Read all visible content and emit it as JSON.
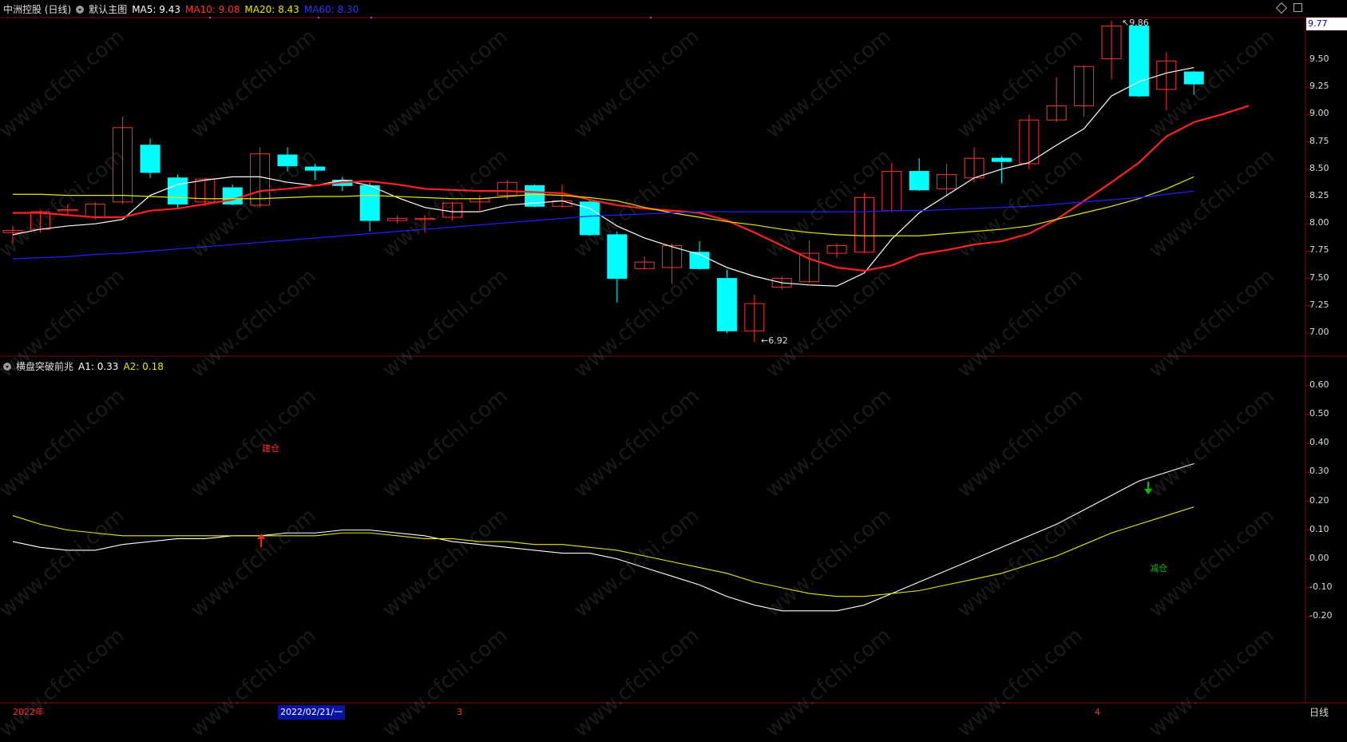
{
  "main_panel": {
    "stock_name": "中洲控股 (日线)",
    "template_label": "默认主图",
    "ma5": "MA5: 9.43",
    "ma10": "MA10: 9.08",
    "ma20": "MA20: 8.43",
    "ma60": "MA60: 8.30",
    "current_price_box": "9.77",
    "high_marker": "9.86",
    "low_marker": "6.92",
    "y_ticks": [
      "9.50",
      "9.25",
      "9.00",
      "8.75",
      "8.50",
      "8.25",
      "8.00",
      "7.75",
      "7.50",
      "7.25",
      "7.00"
    ]
  },
  "indicator_panel": {
    "name": "横盘突破前兆",
    "a1": "A1: 0.33",
    "a2": "A2: 0.18",
    "label_build": "建仓",
    "label_reduce": "减仓",
    "y_ticks": [
      "0.60",
      "0.50",
      "0.40",
      "0.30",
      "0.20",
      "0.10",
      "0.00",
      "-0.10",
      "-0.20"
    ]
  },
  "bottom_bar": {
    "year_label": "2022年",
    "date_cursor": "2022/02/21/一",
    "month_3": "3",
    "month_4": "4",
    "period_button": "日线"
  },
  "watermark": "www.cfchi.com",
  "colors": {
    "up": "#ff3232",
    "down": "#00ffff",
    "ma5": "#ffffff",
    "ma10": "#ff2020",
    "ma20": "#e8e800",
    "ma60": "#2020ff",
    "grid": "#7a1010"
  },
  "chart_data": {
    "type": "candlestick",
    "y_range": [
      6.82,
      9.86
    ],
    "candles": [
      {
        "o": 7.92,
        "h": 7.98,
        "l": 7.82,
        "c": 7.94
      },
      {
        "o": 7.95,
        "h": 8.13,
        "l": 7.92,
        "c": 8.11
      },
      {
        "o": 8.13,
        "h": 8.18,
        "l": 8.07,
        "c": 8.13
      },
      {
        "o": 8.06,
        "h": 8.2,
        "l": 8.04,
        "c": 8.18
      },
      {
        "o": 8.2,
        "h": 8.98,
        "l": 8.18,
        "c": 8.88
      },
      {
        "o": 8.72,
        "h": 8.78,
        "l": 8.42,
        "c": 8.47
      },
      {
        "o": 8.42,
        "h": 8.45,
        "l": 8.13,
        "c": 8.18
      },
      {
        "o": 8.2,
        "h": 8.42,
        "l": 8.16,
        "c": 8.41
      },
      {
        "o": 8.33,
        "h": 8.36,
        "l": 8.17,
        "c": 8.18
      },
      {
        "o": 8.17,
        "h": 8.7,
        "l": 8.15,
        "c": 8.64
      },
      {
        "o": 8.63,
        "h": 8.7,
        "l": 8.48,
        "c": 8.53
      },
      {
        "o": 8.52,
        "h": 8.55,
        "l": 8.4,
        "c": 8.49
      },
      {
        "o": 8.4,
        "h": 8.43,
        "l": 8.3,
        "c": 8.35
      },
      {
        "o": 8.35,
        "h": 8.38,
        "l": 7.93,
        "c": 8.03
      },
      {
        "o": 8.03,
        "h": 8.08,
        "l": 8.0,
        "c": 8.05
      },
      {
        "o": 8.05,
        "h": 8.08,
        "l": 7.92,
        "c": 8.05
      },
      {
        "o": 8.06,
        "h": 8.2,
        "l": 8.03,
        "c": 8.19
      },
      {
        "o": 8.2,
        "h": 8.26,
        "l": 8.12,
        "c": 8.23
      },
      {
        "o": 8.26,
        "h": 8.4,
        "l": 8.22,
        "c": 8.38
      },
      {
        "o": 8.35,
        "h": 8.36,
        "l": 8.15,
        "c": 8.16
      },
      {
        "o": 8.16,
        "h": 8.36,
        "l": 8.15,
        "c": 8.21
      },
      {
        "o": 8.2,
        "h": 8.22,
        "l": 7.89,
        "c": 7.9
      },
      {
        "o": 7.9,
        "h": 7.93,
        "l": 7.28,
        "c": 7.5
      },
      {
        "o": 7.59,
        "h": 7.7,
        "l": 7.58,
        "c": 7.65
      },
      {
        "o": 7.6,
        "h": 7.82,
        "l": 7.45,
        "c": 7.8
      },
      {
        "o": 7.74,
        "h": 7.84,
        "l": 7.58,
        "c": 7.59
      },
      {
        "o": 7.5,
        "h": 7.58,
        "l": 7.0,
        "c": 7.02
      },
      {
        "o": 7.02,
        "h": 7.35,
        "l": 6.92,
        "c": 7.27
      },
      {
        "o": 7.42,
        "h": 7.52,
        "l": 7.4,
        "c": 7.5
      },
      {
        "o": 7.47,
        "h": 7.85,
        "l": 7.46,
        "c": 7.73
      },
      {
        "o": 7.73,
        "h": 7.82,
        "l": 7.69,
        "c": 7.8
      },
      {
        "o": 7.74,
        "h": 8.28,
        "l": 7.73,
        "c": 8.24
      },
      {
        "o": 8.12,
        "h": 8.56,
        "l": 8.11,
        "c": 8.48
      },
      {
        "o": 8.48,
        "h": 8.6,
        "l": 8.3,
        "c": 8.31
      },
      {
        "o": 8.32,
        "h": 8.55,
        "l": 8.25,
        "c": 8.45
      },
      {
        "o": 8.42,
        "h": 8.7,
        "l": 8.38,
        "c": 8.6
      },
      {
        "o": 8.6,
        "h": 8.62,
        "l": 8.37,
        "c": 8.57
      },
      {
        "o": 8.55,
        "h": 9.0,
        "l": 8.5,
        "c": 8.95
      },
      {
        "o": 8.95,
        "h": 9.34,
        "l": 8.93,
        "c": 9.08
      },
      {
        "o": 9.08,
        "h": 9.45,
        "l": 8.98,
        "c": 9.44
      },
      {
        "o": 9.51,
        "h": 9.86,
        "l": 9.32,
        "c": 9.81
      },
      {
        "o": 9.81,
        "h": 9.82,
        "l": 9.16,
        "c": 9.17
      },
      {
        "o": 9.23,
        "h": 9.57,
        "l": 9.04,
        "c": 9.49
      },
      {
        "o": 9.39,
        "h": 9.4,
        "l": 9.18,
        "c": 9.28
      }
    ],
    "ma_series": [
      {
        "name": "MA5",
        "values": [
          7.9,
          7.95,
          7.98,
          8.0,
          8.04,
          8.26,
          8.36,
          8.4,
          8.43,
          8.43,
          8.38,
          8.35,
          8.4,
          8.35,
          8.24,
          8.15,
          8.11,
          8.11,
          8.17,
          8.19,
          8.21,
          8.14,
          7.98,
          7.87,
          7.79,
          7.72,
          7.6,
          7.52,
          7.46,
          7.44,
          7.43,
          7.55,
          7.86,
          8.1,
          8.26,
          8.42,
          8.5,
          8.56,
          8.72,
          8.87,
          9.17,
          9.3,
          9.38,
          9.43
        ]
      },
      {
        "name": "MA10",
        "values": [
          8.1,
          8.1,
          8.08,
          8.06,
          8.06,
          8.12,
          8.14,
          8.18,
          8.22,
          8.3,
          8.32,
          8.35,
          8.38,
          8.39,
          8.36,
          8.32,
          8.31,
          8.3,
          8.3,
          8.29,
          8.28,
          8.22,
          8.17,
          8.14,
          8.12,
          8.1,
          8.03,
          7.92,
          7.8,
          7.68,
          7.6,
          7.57,
          7.62,
          7.72,
          7.76,
          7.81,
          7.84,
          7.91,
          8.04,
          8.21,
          8.38,
          8.56,
          8.8,
          8.93,
          9.0,
          9.08
        ]
      },
      {
        "name": "MA20",
        "values": [
          8.27,
          8.27,
          8.26,
          8.26,
          8.26,
          8.25,
          8.24,
          8.23,
          8.23,
          8.23,
          8.24,
          8.25,
          8.25,
          8.26,
          8.25,
          8.24,
          8.23,
          8.23,
          8.25,
          8.27,
          8.26,
          8.24,
          8.21,
          8.15,
          8.1,
          8.06,
          8.02,
          7.99,
          7.95,
          7.92,
          7.9,
          7.89,
          7.89,
          7.89,
          7.91,
          7.93,
          7.95,
          7.98,
          8.04,
          8.1,
          8.16,
          8.23,
          8.32,
          8.43
        ]
      },
      {
        "name": "MA60",
        "values": [
          7.68,
          7.69,
          7.7,
          7.72,
          7.73,
          7.75,
          7.77,
          7.79,
          7.81,
          7.83,
          7.85,
          7.87,
          7.89,
          7.91,
          7.93,
          7.95,
          7.97,
          7.99,
          8.01,
          8.03,
          8.05,
          8.07,
          8.08,
          8.09,
          8.1,
          8.11,
          8.11,
          8.11,
          8.11,
          8.11,
          8.11,
          8.11,
          8.12,
          8.12,
          8.13,
          8.14,
          8.15,
          8.16,
          8.18,
          8.2,
          8.22,
          8.24,
          8.27,
          8.3
        ]
      }
    ],
    "indicator": {
      "y_range": [
        -0.25,
        0.67
      ],
      "series": [
        {
          "name": "A1",
          "values": [
            0.06,
            0.04,
            0.03,
            0.03,
            0.05,
            0.06,
            0.07,
            0.07,
            0.08,
            0.08,
            0.09,
            0.09,
            0.1,
            0.1,
            0.09,
            0.08,
            0.06,
            0.05,
            0.04,
            0.03,
            0.02,
            0.02,
            0.0,
            -0.03,
            -0.06,
            -0.09,
            -0.13,
            -0.16,
            -0.18,
            -0.18,
            -0.18,
            -0.16,
            -0.12,
            -0.08,
            -0.04,
            0.0,
            0.04,
            0.08,
            0.12,
            0.17,
            0.22,
            0.27,
            0.3,
            0.33
          ]
        },
        {
          "name": "A2",
          "values": [
            0.15,
            0.12,
            0.1,
            0.09,
            0.08,
            0.08,
            0.08,
            0.08,
            0.08,
            0.08,
            0.08,
            0.08,
            0.09,
            0.09,
            0.08,
            0.07,
            0.07,
            0.06,
            0.06,
            0.05,
            0.05,
            0.04,
            0.03,
            0.01,
            -0.01,
            -0.03,
            -0.05,
            -0.08,
            -0.1,
            -0.12,
            -0.13,
            -0.13,
            -0.12,
            -0.11,
            -0.09,
            -0.07,
            -0.05,
            -0.02,
            0.01,
            0.05,
            0.09,
            0.12,
            0.15,
            0.18
          ]
        }
      ]
    }
  }
}
